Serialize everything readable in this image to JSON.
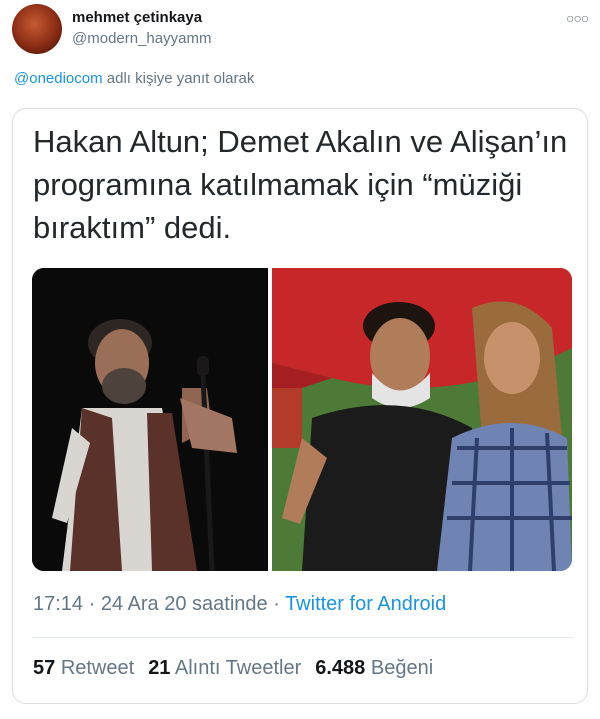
{
  "user": {
    "name": "mehmet çetinkaya",
    "handle": "@modern_hayyamm"
  },
  "reply": {
    "mention": "@onediocom",
    "suffix": " adlı kişiye yanıt olarak"
  },
  "tweet": {
    "text": "Hakan Altun; Demet Akalın ve Alişan’ın programına katılmamak için “müziği bıraktım” dedi."
  },
  "meta": {
    "time": "17:14",
    "separator": " · ",
    "date": "24 Ara 20 saatinde",
    "app": "Twitter for Android"
  },
  "stats": {
    "retweets_count": "57",
    "retweets_label": "Retweet",
    "quotes_count": "21",
    "quotes_label": "Alıntı Tweetler",
    "likes_count": "6.488",
    "likes_label": "Beğeni"
  }
}
